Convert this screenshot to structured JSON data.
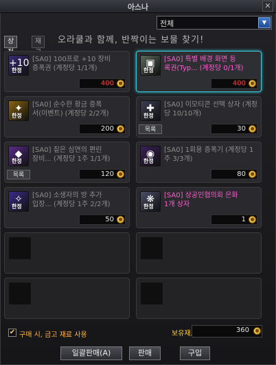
{
  "window": {
    "title": "아스나"
  },
  "filter": {
    "selected": "전체"
  },
  "tabs": [
    {
      "label": "상점",
      "active": true
    },
    {
      "label": "재구입",
      "active": false
    }
  ],
  "banner": "오라쿨과 함께, 반짝이는 보물 찾기!",
  "items": [
    {
      "name": "[SA0] 100프로 +10 장비\n증폭권",
      "limit": "(계정당 1/1개)",
      "price": "400",
      "price_color": "red",
      "icon_color": "#3a2b78",
      "icon_glyph": "+10",
      "has_list": false,
      "selected": false
    },
    {
      "name": "[SA0] 특별 배경 화면 등\n록권(Typ...",
      "limit": "(계정당 0/1개)",
      "price": "400",
      "price_color": "red",
      "icon_color": "#5a6a5c",
      "icon_glyph": "▣",
      "has_list": false,
      "selected": true
    },
    {
      "name": "[SA0] 순수한 황금 증폭\n서(이벤트)",
      "limit": "(계정당 2/2개)",
      "price": "200",
      "price_color": "white",
      "icon_color": "#8a6410",
      "icon_glyph": "✦",
      "has_list": false,
      "selected": false
    },
    {
      "name": "[SA0] 이모티콘 선택 상자",
      "limit": "(계정당 10/10개)",
      "price": "30",
      "price_color": "white",
      "icon_color": "#3a3e52",
      "icon_glyph": "✚",
      "has_list": true,
      "selected": false
    },
    {
      "name": "[SA0] 짙은 심연의 편린\n장비...",
      "limit": "(계정당 1주 1/1개)",
      "price": "120",
      "price_color": "white",
      "icon_color": "#5b2a8c",
      "icon_glyph": "◆",
      "has_list": true,
      "selected": false
    },
    {
      "name": "[SA0] 1회용 증폭기",
      "limit": "(계정당 1주 3/3개)",
      "price": "80",
      "price_color": "white",
      "icon_color": "#3c1f5a",
      "icon_glyph": "◉",
      "has_list": false,
      "selected": false
    },
    {
      "name": "[SA0] 소생자의 방 추가\n입장...",
      "limit": "(계정당 1주 2/2개)",
      "price": "50",
      "price_color": "white",
      "icon_color": "#3a2c8a",
      "icon_glyph": "✧",
      "has_list": false,
      "selected": false
    },
    {
      "name": "[SA0] 상공인협의회 은화\n1개 상자",
      "limit": "",
      "price": "1",
      "price_color": "white",
      "icon_color": "#4a4f6a",
      "icon_glyph": "❋",
      "has_list": false,
      "selected": false,
      "highlight": true
    }
  ],
  "limit_badge": "한정",
  "list_button": "목록",
  "empty_slots": 4,
  "footer": {
    "checkbox_label": "구매 시, 금고 재료 사용",
    "checkbox_checked": true,
    "owned_label": "보유재료:",
    "owned_value": "360",
    "buttons": {
      "bulk_sell": "일괄판매(A)",
      "sell": "판매",
      "buy": "구입"
    }
  }
}
